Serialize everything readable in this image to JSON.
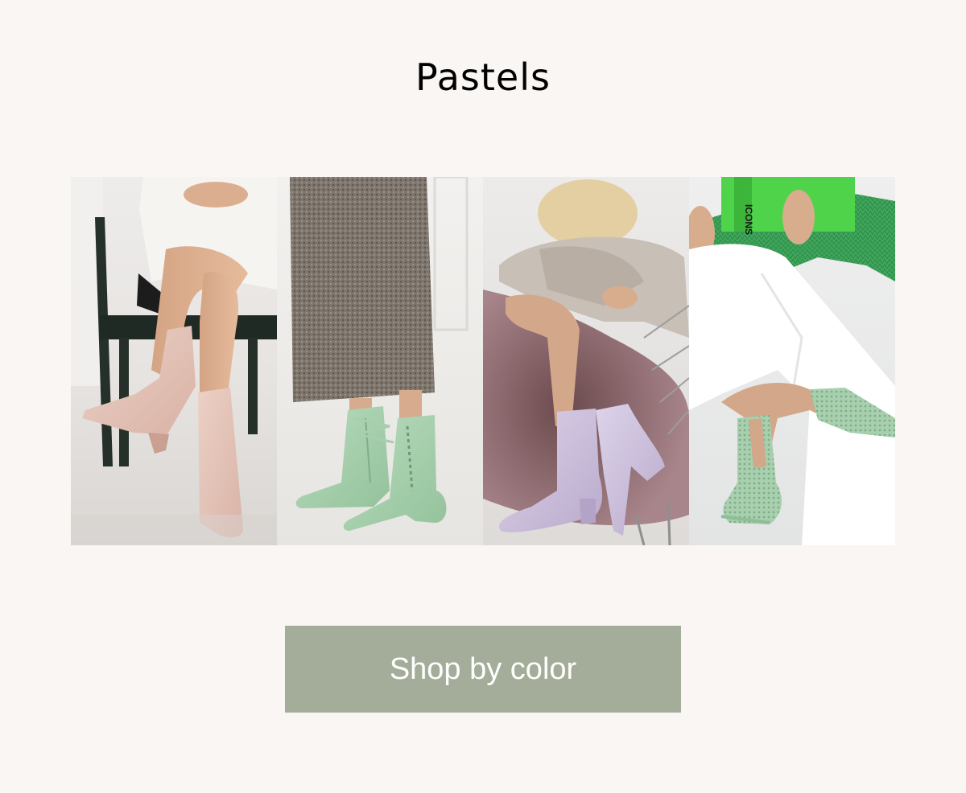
{
  "header": {
    "title": "Pastels"
  },
  "gallery": {
    "photos": [
      {
        "subject": "pink-ankle-boots",
        "boot_color": "#e4c3b8",
        "background_color": "#e9e7e5"
      },
      {
        "subject": "mint-lace-up-ankle-boots",
        "boot_color": "#a8cfae",
        "background_color": "#ecebe8"
      },
      {
        "subject": "lilac-ankle-boots",
        "boot_color": "#ccc2dc",
        "background_color": "#dcd8d6"
      },
      {
        "subject": "mint-mesh-peep-toe-boots",
        "boot_color": "#a9d2b0",
        "background_color": "#e9eaea"
      }
    ],
    "book_text": "ICONS",
    "book_color": "#4fd34b"
  },
  "cta": {
    "label": "Shop by color",
    "background_color": "#a3ad99"
  }
}
